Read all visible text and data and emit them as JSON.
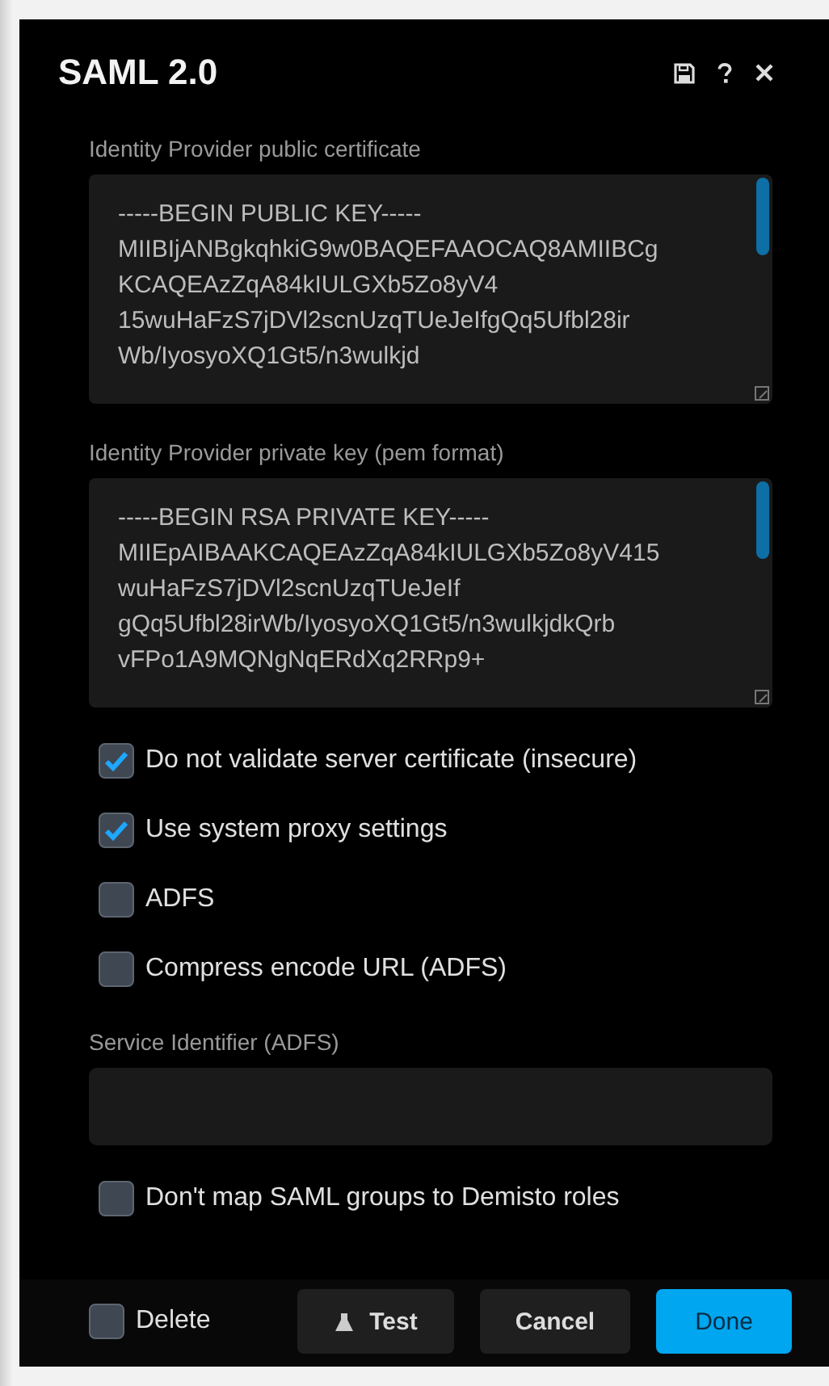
{
  "dialog": {
    "title": "SAML 2.0"
  },
  "fields": [
    {
      "label": "Identity Provider public certificate",
      "lines": [
        "-----BEGIN PUBLIC KEY-----",
        "MIIBIjANBgkqhkiG9w0BAQEFAAOCAQ8AMIIBCg",
        "KCAQEAzZqA84kIULGXb5Zo8yV4",
        "15wuHaFzS7jDVl2scnUzqTUeJeIfgQq5Ufbl28ir",
        "Wb/IyosyoXQ1Gt5/n3wulkjd"
      ]
    },
    {
      "label": "Identity Provider private key (pem format)",
      "lines": [
        "-----BEGIN RSA PRIVATE KEY-----",
        "MIIEpAIBAAKCAQEAzZqA84kIULGXb5Zo8yV415",
        "wuHaFzS7jDVl2scnUzqTUeJeIf",
        "gQq5Ufbl28irWb/IyosyoXQ1Gt5/n3wulkjdkQrb",
        "vFPo1A9MQNgNqERdXq2RRp9+"
      ]
    }
  ],
  "options": [
    {
      "label": "Do not validate server certificate (insecure)",
      "checked": true
    },
    {
      "label": "Use system proxy settings",
      "checked": true
    },
    {
      "label": "ADFS",
      "checked": false
    },
    {
      "label": "Compress encode URL (ADFS)",
      "checked": false
    }
  ],
  "service_identifier": {
    "label": "Service Identifier (ADFS)"
  },
  "roles_option": {
    "label": "Don't map SAML groups to Demisto roles",
    "checked": false
  },
  "footer": {
    "delete": {
      "label": "Delete",
      "checked": false
    },
    "buttons": [
      {
        "label": "Test",
        "kind": "test"
      },
      {
        "label": "Cancel",
        "kind": "cancel"
      },
      {
        "label": "Done",
        "kind": "done"
      }
    ]
  }
}
